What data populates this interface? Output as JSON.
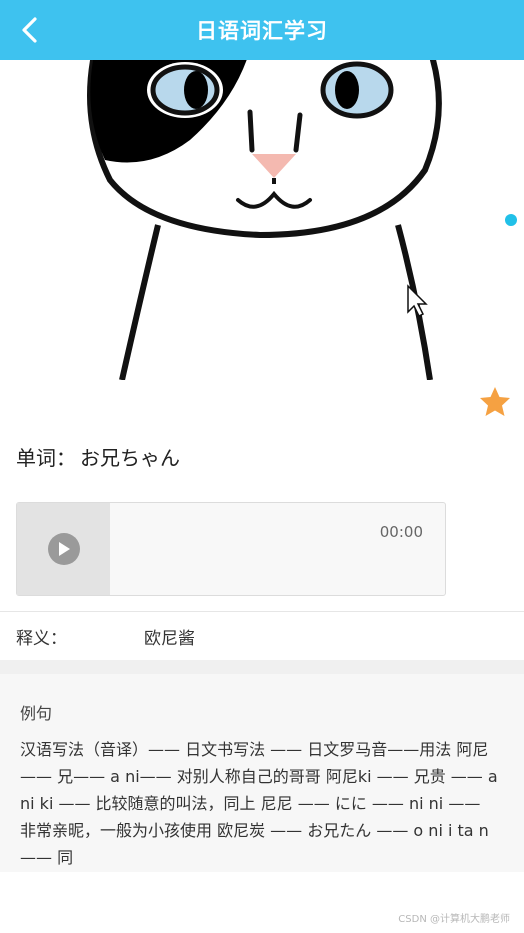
{
  "header": {
    "title": "日语词汇学习",
    "back_icon": "chevron-left-icon"
  },
  "favorite": {
    "icon": "star-icon",
    "color": "#f5a142"
  },
  "word": {
    "label": "单词：",
    "value": "お兄ちゃん"
  },
  "audio": {
    "time": "00:00",
    "icon": "play-icon"
  },
  "meaning": {
    "label": "释义：",
    "value": "欧尼酱"
  },
  "example": {
    "title": "例句",
    "text": "汉语写法（音译）—— 日文书写法 —— 日文罗马音——用法 阿尼—— 兄—— a ni—— 对别人称自己的哥哥 阿尼ki —— 兄贵 —— a ni ki —— 比较随意的叫法，同上 尼尼 —— にに —— ni ni —— 非常亲昵，一般为小孩使用 欧尼炭 —— お兄たん —— o ni i ta n —— 同"
  },
  "watermark": "CSDN @计算机大鹏老师",
  "colors": {
    "accent": "#3ec2ef",
    "dot": "#21c0e8"
  }
}
